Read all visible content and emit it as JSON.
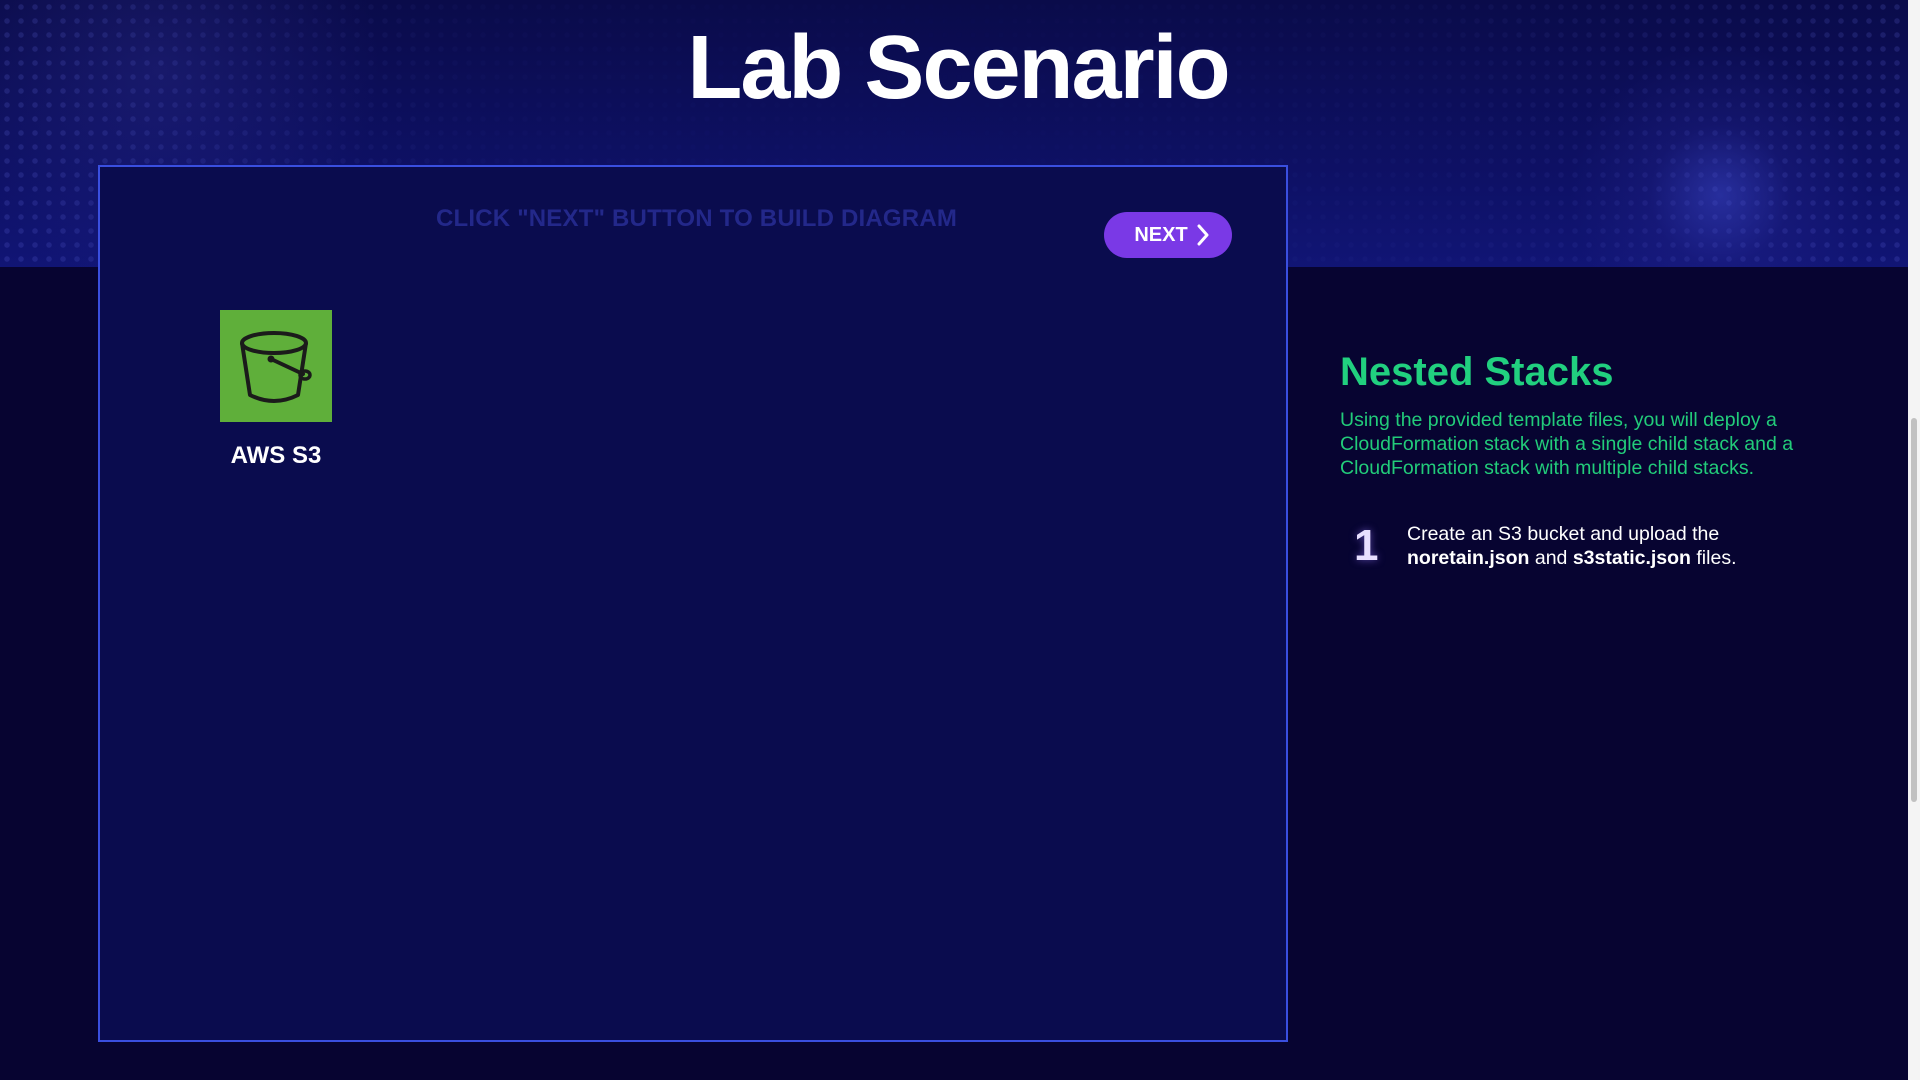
{
  "header": {
    "title": "Lab Scenario"
  },
  "diagram": {
    "hint": "CLICK \"NEXT\" BUTTON TO BUILD DIAGRAM",
    "next_label": "NEXT",
    "next_icon": "chevron-right-icon",
    "node": {
      "icon": "s3-bucket-icon",
      "label": "AWS S3",
      "color": "#5faf3a"
    }
  },
  "info": {
    "title": "Nested Stacks",
    "description": "Using the provided template files, you will deploy a CloudFormation stack with a single child stack and a CloudFormation stack with multiple child stacks.",
    "steps": [
      {
        "number": "1",
        "text_before": "Create an S3 bucket and upload the",
        "file_1": "noretain.json",
        "joiner": "and",
        "file_2": "s3static.json",
        "text_after": "files."
      }
    ]
  },
  "colors": {
    "accent_green": "#21d07f",
    "button_purple": "#7a39e6",
    "panel_border": "#3a4fe0",
    "background": "#070431"
  }
}
